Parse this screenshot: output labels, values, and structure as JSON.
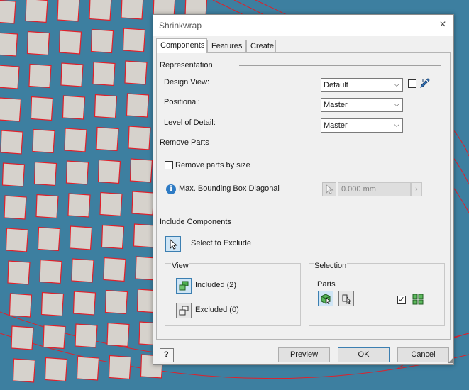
{
  "window": {
    "title": "Shrinkwrap",
    "close_icon": "×"
  },
  "tabs": [
    {
      "label": "Components",
      "active": true
    },
    {
      "label": "Features",
      "active": false
    },
    {
      "label": "Create",
      "active": false
    }
  ],
  "representation": {
    "heading": "Representation",
    "design_view_label": "Design View:",
    "design_view_value": "Default",
    "positional_label": "Positional:",
    "positional_value": "Master",
    "lod_label": "Level of Detail:",
    "lod_value": "Master",
    "associative_checked": false
  },
  "remove_parts": {
    "heading": "Remove Parts",
    "by_size_label": "Remove parts by size",
    "by_size_checked": false,
    "max_diag_label": "Max. Bounding Box Diagonal",
    "max_diag_value": "0.000 mm"
  },
  "include_components": {
    "heading": "Include Components",
    "select_exclude_label": "Select to Exclude",
    "view_heading": "View",
    "included_label": "Included (2)",
    "excluded_label": "Excluded (0)",
    "selection_heading": "Selection",
    "parts_label": "Parts",
    "select_all_checked": true
  },
  "footer": {
    "help_icon": "?",
    "preview_label": "Preview",
    "ok_label": "OK",
    "cancel_label": "Cancel"
  },
  "colors": {
    "viewport_bg": "#3d7fa0",
    "edge_red": "#e0202a",
    "face_gray": "#d6d2cc",
    "accent_blue": "#3c7fb1"
  }
}
